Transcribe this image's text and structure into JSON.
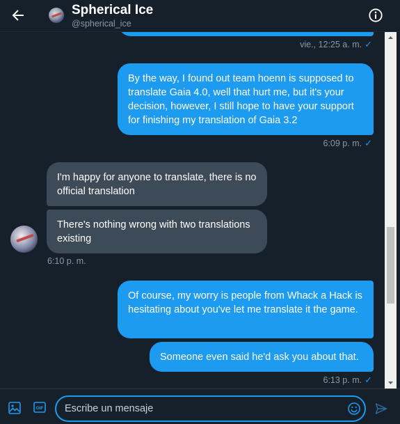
{
  "header": {
    "title": "Spherical Ice",
    "handle": "@spherical_ice",
    "back_icon": "arrow-left-icon",
    "info_icon": "info-circle-icon"
  },
  "messages": [
    {
      "id": "m0",
      "direction": "out",
      "text": "",
      "time": "vie., 12:25 a. m."
    },
    {
      "id": "m1",
      "direction": "out",
      "text": "By the way, I found out team hoenn is supposed to translate Gaia 4.0, well that hurt me, but it's your decision, however, I still hope to have your support for finishing my translation of Gaia 3.2",
      "time": "6:09 p. m."
    },
    {
      "id": "m2",
      "direction": "in",
      "text": "I'm happy for anyone to translate, there is no official translation"
    },
    {
      "id": "m3",
      "direction": "in",
      "text": "There's nothing wrong with two translations existing",
      "time": "6:10 p. m."
    },
    {
      "id": "m4",
      "direction": "out",
      "text": "Of course, my worry is people from Whack a Hack is hesitating about you've let me translate it the game."
    },
    {
      "id": "m5",
      "direction": "out",
      "text": "Someone even said he'd ask you about that.",
      "time": "6:13 p. m."
    }
  ],
  "composer": {
    "placeholder": "Escribe un mensaje",
    "gif_label": "GIF",
    "media_icon": "image-icon",
    "emoji_icon": "emoji-icon",
    "send_icon": "send-icon"
  },
  "colors": {
    "background": "#15202b",
    "outgoing_bubble": "#1d9bf0",
    "incoming_bubble": "#3d4a57",
    "secondary_text": "#8b98a5",
    "accent": "#1d9bf0"
  },
  "check_mark": "✓"
}
